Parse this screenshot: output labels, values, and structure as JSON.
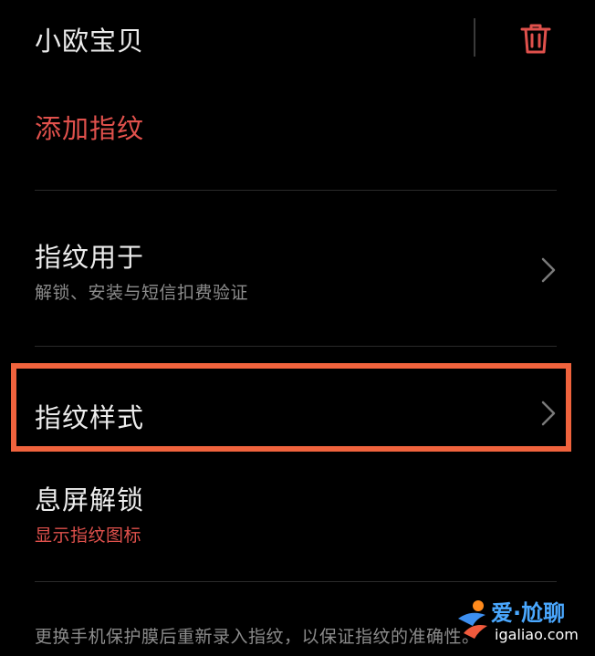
{
  "fingerprint": {
    "name": "小欧宝贝",
    "delete_icon": "trash-icon",
    "delete_color": "#e0514c"
  },
  "add_fingerprint": {
    "label": "添加指纹",
    "color": "#e0514c"
  },
  "settings": [
    {
      "title": "指纹用于",
      "subtitle": "解锁、安装与短信扣费验证"
    },
    {
      "title": "指纹样式",
      "highlighted": true,
      "highlight_color": "#f0633d"
    },
    {
      "title": "息屏解锁",
      "subtitle": "显示指纹图标"
    }
  ],
  "footnote": "更换手机保护膜后重新录入指纹，以保证指纹的准确性。",
  "watermark": {
    "top": "爱·尬聊",
    "bottom": "igaliao.com"
  }
}
